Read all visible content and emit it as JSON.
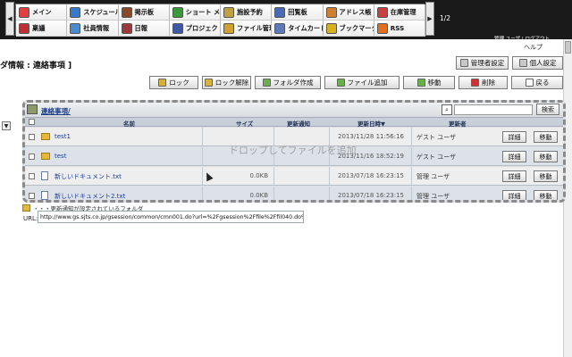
{
  "menu": {
    "page_indicator": "1/2",
    "items": [
      {
        "label": "メイン",
        "icon": "home-icon",
        "color": "#e24040"
      },
      {
        "label": "スケジュール",
        "icon": "calendar-icon",
        "color": "#3a78c8"
      },
      {
        "label": "掲示板",
        "icon": "board-icon",
        "color": "#8a4a2a"
      },
      {
        "label": "ショート メール",
        "icon": "mail-icon",
        "color": "#3a9a3a"
      },
      {
        "label": "施設予約",
        "icon": "facility-icon",
        "color": "#c0a040"
      },
      {
        "label": "回覧板",
        "icon": "circular-icon",
        "color": "#4a6ab8"
      },
      {
        "label": "アドレス帳",
        "icon": "address-book-icon",
        "color": "#d08030"
      },
      {
        "label": "在庫管理",
        "icon": "inventory-icon",
        "color": "#c84040"
      },
      {
        "label": "稟議",
        "icon": "approval-icon",
        "color": "#c03030"
      },
      {
        "label": "社員情報",
        "icon": "employee-icon",
        "color": "#4a8ad0"
      },
      {
        "label": "日報",
        "icon": "daily-report-icon",
        "color": "#9a3a3a"
      },
      {
        "label": "プロジェクト",
        "icon": "project-icon",
        "color": "#3a5aa8"
      },
      {
        "label": "ファイル管理",
        "icon": "file-manager-icon",
        "color": "#d0a030"
      },
      {
        "label": "タイムカード",
        "icon": "timecard-icon",
        "color": "#5a7ab8"
      },
      {
        "label": "ブックマーク",
        "icon": "bookmark-icon",
        "color": "#d8b020"
      },
      {
        "label": "RSS",
        "icon": "rss-icon",
        "color": "#e07020"
      }
    ]
  },
  "user_strip": "管理 ユーザ | ログアウト",
  "help_label": "ヘルプ",
  "page_title": "ダ情報 : 連絡事項 ]",
  "buttons": {
    "admin_settings": "管理者設定",
    "personal_settings": "個人設定",
    "lock": "ロック",
    "unlock": "ロック解除",
    "create_folder": "フォルダ作成",
    "add_file": "ファイル追加",
    "move": "移動",
    "delete": "削除",
    "back": "戻る"
  },
  "panel": {
    "path": "連絡事項/",
    "search_button": "検索",
    "drop_hint": "ドロップしてファイルを追加",
    "columns": {
      "name": "名前",
      "size": "サイズ",
      "notify": "更新通知",
      "updated": "更新日時▼",
      "updater": "更新者"
    },
    "detail_label": "詳細",
    "move_label": "移動",
    "rows": [
      {
        "type": "folder",
        "name": "test1",
        "size": "",
        "date": "2013/11/28 11:56:16",
        "updater": "ゲスト ユーザ"
      },
      {
        "type": "folder",
        "name": "test",
        "size": "",
        "date": "2013/11/16 18:52:19",
        "updater": "ゲスト ユーザ"
      },
      {
        "type": "file",
        "name": "新しいドキュメント.txt",
        "size": "0.0KB",
        "date": "2013/07/18 16:23:15",
        "updater": "管理 ユーザ"
      },
      {
        "type": "file",
        "name": "新しいドキュメント2.txt",
        "size": "0.0KB",
        "date": "2013/07/18 16:23:15",
        "updater": "管理 ユーザ"
      }
    ]
  },
  "legend_text": "・・・更新通知が設定されているフォルダ",
  "url_label": "URL:",
  "url_value": "http://www.gs.sjts.co.jp/gsession/common/cmn001.do?url=%2Fgsession%2Ffile%2Ffil040.do%3Ffi"
}
